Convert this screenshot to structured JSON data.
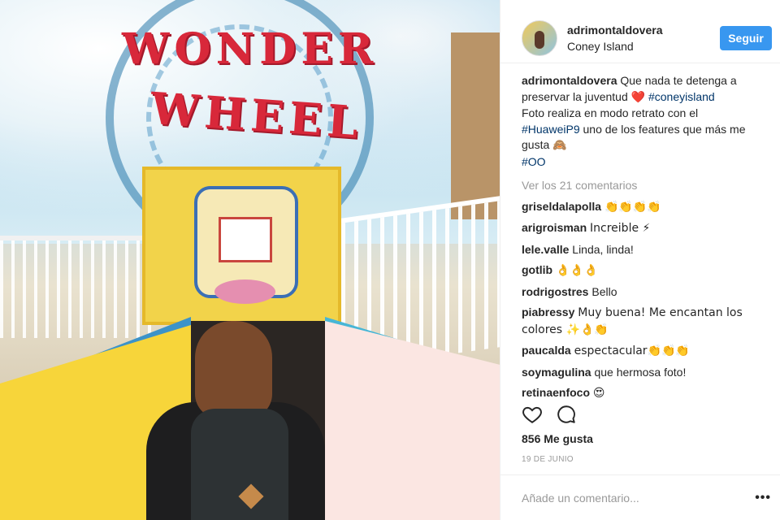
{
  "post": {
    "username": "adrimontaldovera",
    "location": "Coney Island",
    "follow_label": "Seguir",
    "image_sign_top": "WONDER",
    "image_sign_bottom": "WHEEL",
    "caption": {
      "user": "adrimontaldovera",
      "text1": "Que nada te detenga a preservar la juventud",
      "emoji1": "❤️",
      "tag1": "#coneyisland",
      "text2": "Foto realiza en modo retrato con el",
      "tag2": "#HuaweiP9",
      "text3": "uno de los features que más me gusta",
      "emoji2": "🙈",
      "tag3": "#OO"
    },
    "view_all": "Ver los 21 comentarios",
    "comments": [
      {
        "user": "griseldalapolla",
        "text": "👏👏👏👏"
      },
      {
        "user": "arigroisman",
        "text": "Increible ⚡"
      },
      {
        "user": "lele.valle",
        "text": "Linda, linda!"
      },
      {
        "user": "gotlib",
        "text": "👌👌👌"
      },
      {
        "user": "rodrigostres",
        "text": "Bello"
      },
      {
        "user": "piabressy",
        "text": "Muy buena! Me encantan los colores ✨👌👏"
      },
      {
        "user": "paucalda",
        "text": "espectacular👏👏👏"
      },
      {
        "user": "soymagulina",
        "text": "que hermosa foto!"
      },
      {
        "user": "retinaenfoco",
        "text": "😍"
      }
    ],
    "likes": "856 Me gusta",
    "date": "19 DE JUNIO",
    "add_comment_placeholder": "Añade un comentario...",
    "more_label": "•••",
    "icons": [
      "heart-icon",
      "comment-icon",
      "more-options-icon"
    ]
  }
}
